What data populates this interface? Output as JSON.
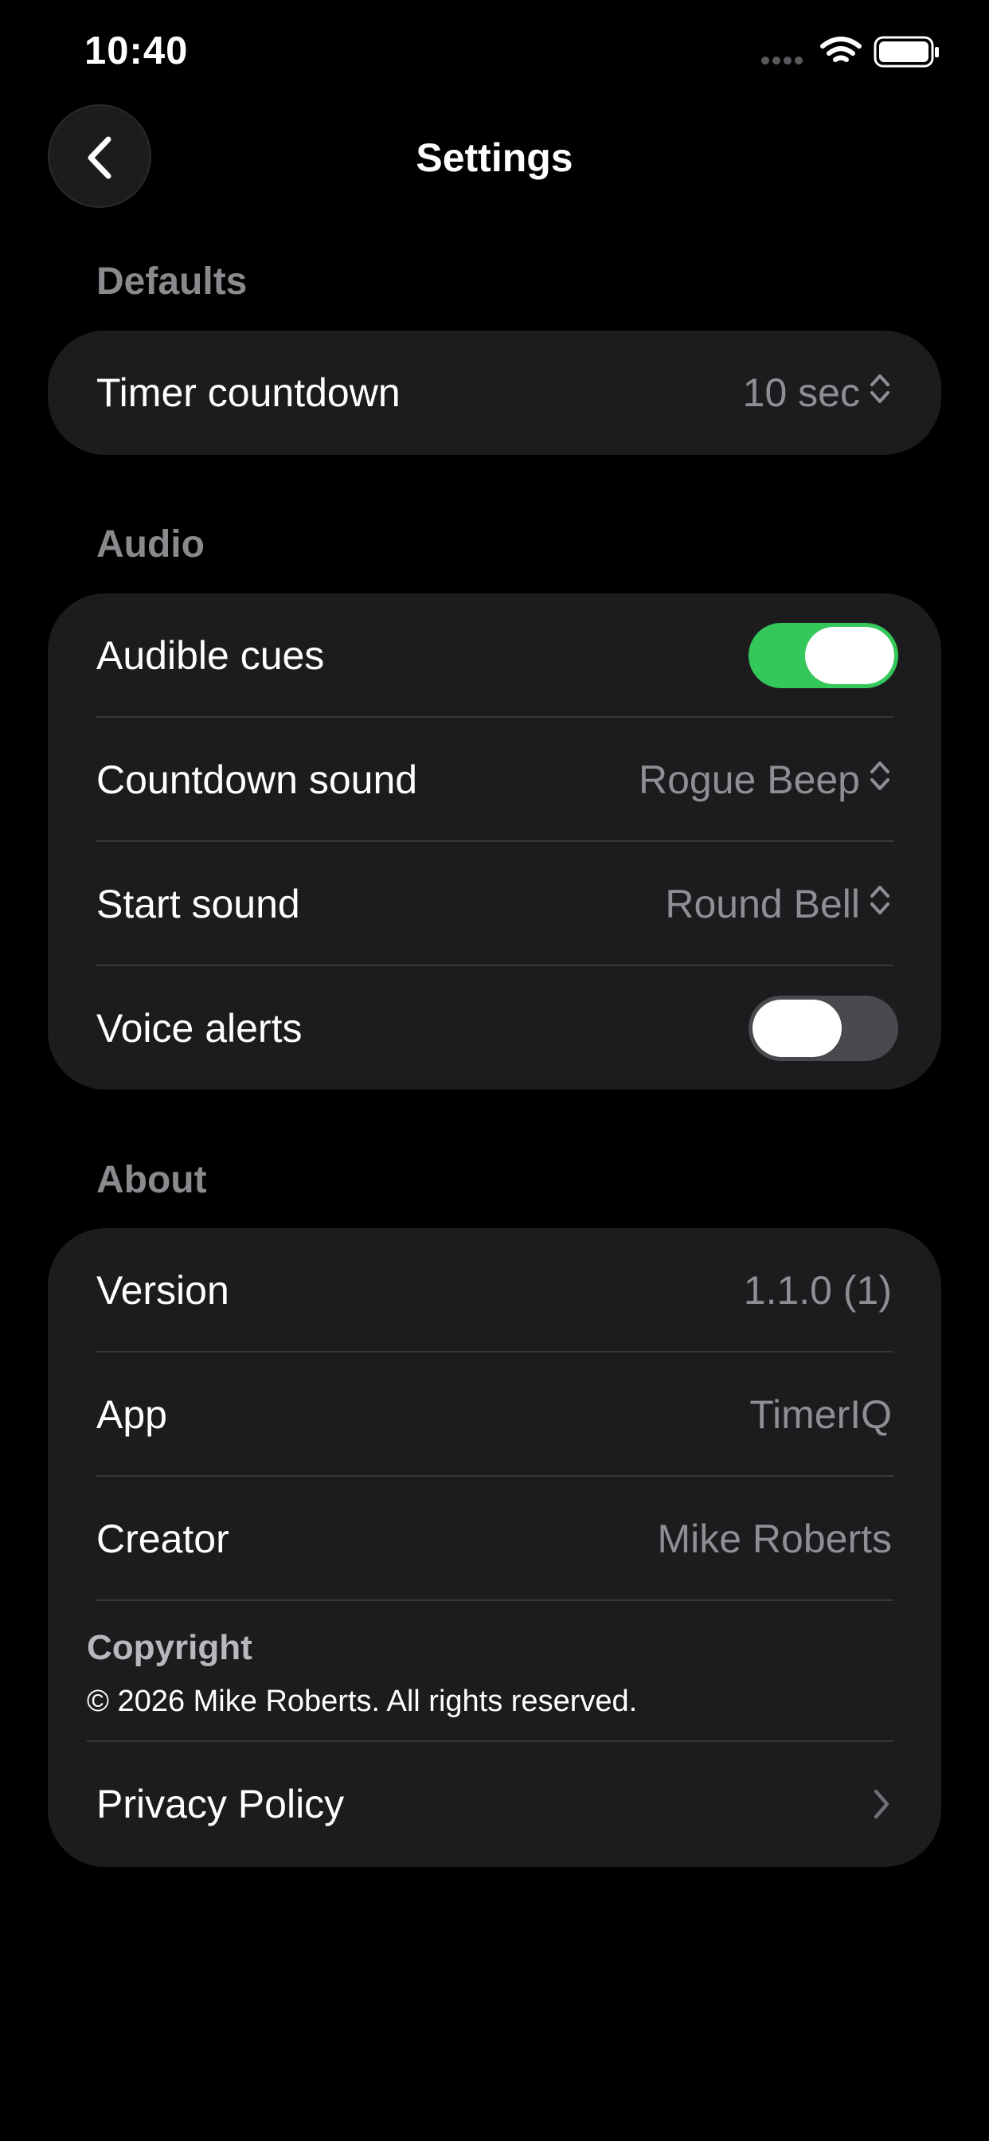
{
  "status_bar": {
    "time": "10:40",
    "icons": [
      "signal-icon",
      "wifi-icon",
      "battery-icon"
    ]
  },
  "nav": {
    "title": "Settings",
    "back_icon": "chevron-left-icon"
  },
  "defaults": {
    "header": "Defaults",
    "timer_countdown": {
      "label": "Timer countdown",
      "value": "10 sec"
    }
  },
  "audio": {
    "header": "Audio",
    "audible_cues": {
      "label": "Audible cues",
      "on": true
    },
    "countdown_sound": {
      "label": "Countdown sound",
      "value": "Rogue Beep"
    },
    "start_sound": {
      "label": "Start sound",
      "value": "Round Bell"
    },
    "voice_alerts": {
      "label": "Voice alerts",
      "on": false
    }
  },
  "about": {
    "header": "About",
    "version": {
      "label": "Version",
      "value": "1.1.0 (1)"
    },
    "app": {
      "label": "App",
      "value": "TimerIQ"
    },
    "creator": {
      "label": "Creator",
      "value": "Mike Roberts"
    },
    "copyright": {
      "title": "Copyright",
      "text": "© 2026 Mike Roberts. All rights reserved."
    },
    "privacy_policy": {
      "label": "Privacy Policy"
    }
  },
  "colors": {
    "background": "#000000",
    "card": "#1c1c1e",
    "toggle_on": "#34c759",
    "toggle_off": "#4a4a4e",
    "secondary_text": "#8e8e93",
    "section_header": "#8a8a8e"
  }
}
